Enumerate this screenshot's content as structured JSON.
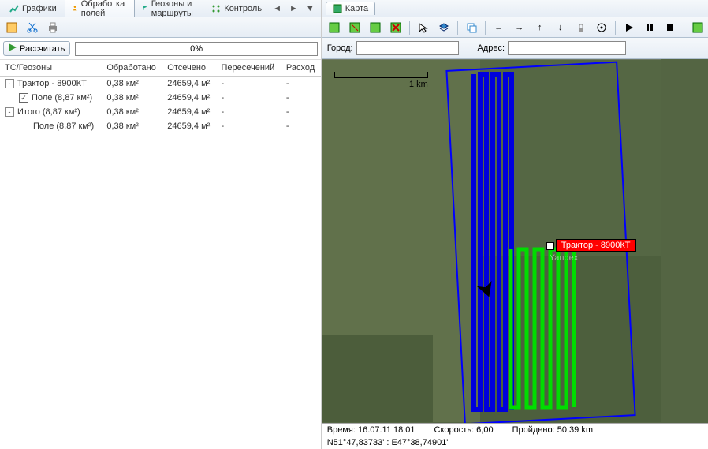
{
  "left": {
    "tabs": [
      {
        "label": "Графики"
      },
      {
        "label": "Обработка полей"
      },
      {
        "label": "Геозоны и маршруты"
      },
      {
        "label": "Контроль"
      }
    ],
    "calc_button": "Рассчитать",
    "progress": "0%",
    "columns": [
      "ТС/Геозоны",
      "Обработано",
      "Отсечено",
      "Пересечений",
      "Расход"
    ],
    "rows": [
      {
        "name": "Трактор - 8900КТ",
        "processed": "0,38 км²",
        "cut": "24659,4 м²",
        "inter": "-",
        "rate": "-",
        "level": 0,
        "toggle": "-"
      },
      {
        "name": "Поле (8,87 км²)",
        "processed": "0,38 км²",
        "cut": "24659,4 м²",
        "inter": "-",
        "rate": "-",
        "level": 1,
        "checked": true
      },
      {
        "name": "Итого (8,87 км²)",
        "processed": "0,38 км²",
        "cut": "24659,4 м²",
        "inter": "-",
        "rate": "-",
        "level": 0,
        "toggle": "-"
      },
      {
        "name": "Поле (8,87 км²)",
        "processed": "0,38 км²",
        "cut": "24659,4 м²",
        "inter": "-",
        "rate": "-",
        "level": 2
      }
    ]
  },
  "right": {
    "tab": "Карта",
    "city_label": "Город:",
    "address_label": "Адрес:",
    "scale": "1 km",
    "vehicle": "Трактор - 8900КТ",
    "attribution": "Yandex",
    "status": {
      "time_label": "Время:",
      "time_value": "16.07.11 18:01",
      "speed_label": "Скорость:",
      "speed_value": "6,00",
      "dist_label": "Пройдено:",
      "dist_value": "50,39 km"
    },
    "coords": "N51°47,83733' : E47°38,74901'"
  }
}
